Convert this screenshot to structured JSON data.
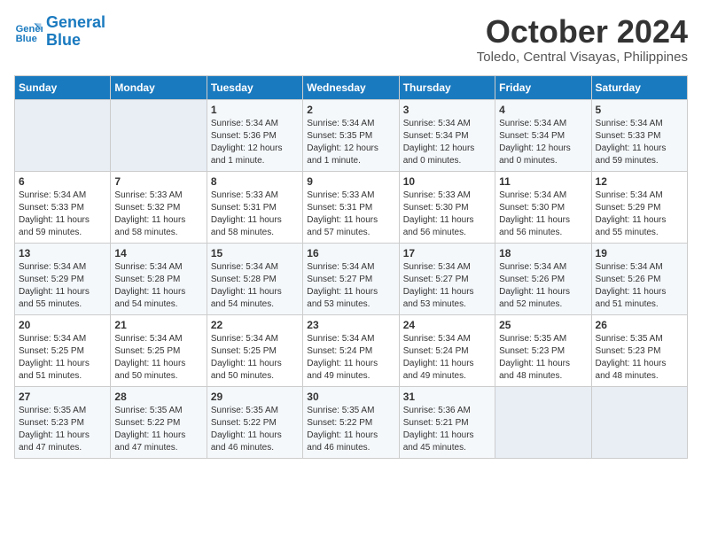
{
  "logo": {
    "line1": "General",
    "line2": "Blue"
  },
  "title": "October 2024",
  "subtitle": "Toledo, Central Visayas, Philippines",
  "headers": [
    "Sunday",
    "Monday",
    "Tuesday",
    "Wednesday",
    "Thursday",
    "Friday",
    "Saturday"
  ],
  "weeks": [
    [
      {
        "day": "",
        "content": ""
      },
      {
        "day": "",
        "content": ""
      },
      {
        "day": "1",
        "content": "Sunrise: 5:34 AM\nSunset: 5:36 PM\nDaylight: 12 hours\nand 1 minute."
      },
      {
        "day": "2",
        "content": "Sunrise: 5:34 AM\nSunset: 5:35 PM\nDaylight: 12 hours\nand 1 minute."
      },
      {
        "day": "3",
        "content": "Sunrise: 5:34 AM\nSunset: 5:34 PM\nDaylight: 12 hours\nand 0 minutes."
      },
      {
        "day": "4",
        "content": "Sunrise: 5:34 AM\nSunset: 5:34 PM\nDaylight: 12 hours\nand 0 minutes."
      },
      {
        "day": "5",
        "content": "Sunrise: 5:34 AM\nSunset: 5:33 PM\nDaylight: 11 hours\nand 59 minutes."
      }
    ],
    [
      {
        "day": "6",
        "content": "Sunrise: 5:34 AM\nSunset: 5:33 PM\nDaylight: 11 hours\nand 59 minutes."
      },
      {
        "day": "7",
        "content": "Sunrise: 5:33 AM\nSunset: 5:32 PM\nDaylight: 11 hours\nand 58 minutes."
      },
      {
        "day": "8",
        "content": "Sunrise: 5:33 AM\nSunset: 5:31 PM\nDaylight: 11 hours\nand 58 minutes."
      },
      {
        "day": "9",
        "content": "Sunrise: 5:33 AM\nSunset: 5:31 PM\nDaylight: 11 hours\nand 57 minutes."
      },
      {
        "day": "10",
        "content": "Sunrise: 5:33 AM\nSunset: 5:30 PM\nDaylight: 11 hours\nand 56 minutes."
      },
      {
        "day": "11",
        "content": "Sunrise: 5:34 AM\nSunset: 5:30 PM\nDaylight: 11 hours\nand 56 minutes."
      },
      {
        "day": "12",
        "content": "Sunrise: 5:34 AM\nSunset: 5:29 PM\nDaylight: 11 hours\nand 55 minutes."
      }
    ],
    [
      {
        "day": "13",
        "content": "Sunrise: 5:34 AM\nSunset: 5:29 PM\nDaylight: 11 hours\nand 55 minutes."
      },
      {
        "day": "14",
        "content": "Sunrise: 5:34 AM\nSunset: 5:28 PM\nDaylight: 11 hours\nand 54 minutes."
      },
      {
        "day": "15",
        "content": "Sunrise: 5:34 AM\nSunset: 5:28 PM\nDaylight: 11 hours\nand 54 minutes."
      },
      {
        "day": "16",
        "content": "Sunrise: 5:34 AM\nSunset: 5:27 PM\nDaylight: 11 hours\nand 53 minutes."
      },
      {
        "day": "17",
        "content": "Sunrise: 5:34 AM\nSunset: 5:27 PM\nDaylight: 11 hours\nand 53 minutes."
      },
      {
        "day": "18",
        "content": "Sunrise: 5:34 AM\nSunset: 5:26 PM\nDaylight: 11 hours\nand 52 minutes."
      },
      {
        "day": "19",
        "content": "Sunrise: 5:34 AM\nSunset: 5:26 PM\nDaylight: 11 hours\nand 51 minutes."
      }
    ],
    [
      {
        "day": "20",
        "content": "Sunrise: 5:34 AM\nSunset: 5:25 PM\nDaylight: 11 hours\nand 51 minutes."
      },
      {
        "day": "21",
        "content": "Sunrise: 5:34 AM\nSunset: 5:25 PM\nDaylight: 11 hours\nand 50 minutes."
      },
      {
        "day": "22",
        "content": "Sunrise: 5:34 AM\nSunset: 5:25 PM\nDaylight: 11 hours\nand 50 minutes."
      },
      {
        "day": "23",
        "content": "Sunrise: 5:34 AM\nSunset: 5:24 PM\nDaylight: 11 hours\nand 49 minutes."
      },
      {
        "day": "24",
        "content": "Sunrise: 5:34 AM\nSunset: 5:24 PM\nDaylight: 11 hours\nand 49 minutes."
      },
      {
        "day": "25",
        "content": "Sunrise: 5:35 AM\nSunset: 5:23 PM\nDaylight: 11 hours\nand 48 minutes."
      },
      {
        "day": "26",
        "content": "Sunrise: 5:35 AM\nSunset: 5:23 PM\nDaylight: 11 hours\nand 48 minutes."
      }
    ],
    [
      {
        "day": "27",
        "content": "Sunrise: 5:35 AM\nSunset: 5:23 PM\nDaylight: 11 hours\nand 47 minutes."
      },
      {
        "day": "28",
        "content": "Sunrise: 5:35 AM\nSunset: 5:22 PM\nDaylight: 11 hours\nand 47 minutes."
      },
      {
        "day": "29",
        "content": "Sunrise: 5:35 AM\nSunset: 5:22 PM\nDaylight: 11 hours\nand 46 minutes."
      },
      {
        "day": "30",
        "content": "Sunrise: 5:35 AM\nSunset: 5:22 PM\nDaylight: 11 hours\nand 46 minutes."
      },
      {
        "day": "31",
        "content": "Sunrise: 5:36 AM\nSunset: 5:21 PM\nDaylight: 11 hours\nand 45 minutes."
      },
      {
        "day": "",
        "content": ""
      },
      {
        "day": "",
        "content": ""
      }
    ]
  ]
}
